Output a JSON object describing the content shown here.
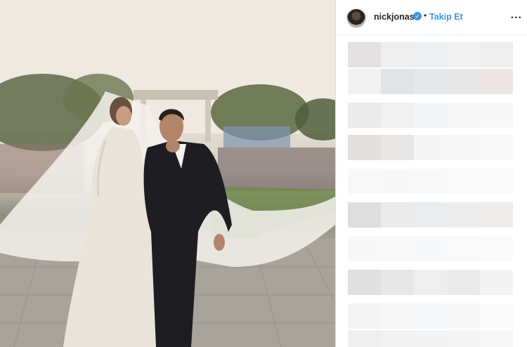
{
  "post": {
    "username": "nickjonas",
    "verified_icon": "verified-check-icon",
    "separator": "•",
    "follow_label": "Takip Et",
    "more_icon": "more-options-icon",
    "more_label": "..."
  },
  "photo": {
    "subject": "wedding-photo"
  },
  "colors": {
    "link_blue": "#3897f0",
    "text_dark": "#262626",
    "border": "#dbdbdb"
  }
}
